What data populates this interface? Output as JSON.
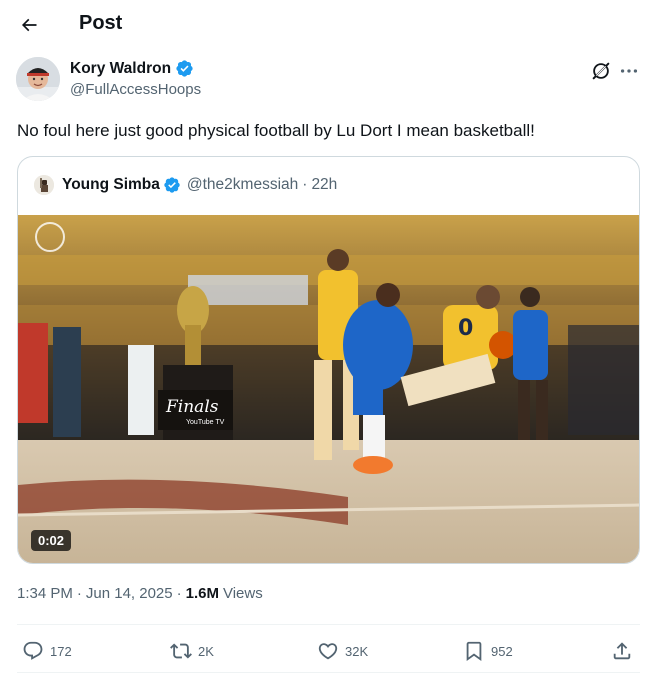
{
  "header": {
    "title": "Post",
    "back_icon": "arrow-left-icon"
  },
  "author": {
    "name": "Kory Waldron",
    "handle": "@FullAccessHoops",
    "verified": true,
    "verified_color": "#1d9bf0"
  },
  "tweet": {
    "text": "No foul here just good physical football by Lu Dort I mean basketball!"
  },
  "quote": {
    "name": "Young Simba",
    "handle": "@the2kmessiah",
    "separator": "·",
    "time": "22h",
    "verified": true,
    "video": {
      "duration": "0:02",
      "overlay_text": [
        "Finals",
        "YouTube TV"
      ]
    }
  },
  "meta": {
    "time": "1:34 PM",
    "sep1": "·",
    "date": "Jun 14, 2025",
    "sep2": "·",
    "views_count": "1.6M",
    "views_label": "Views"
  },
  "actions": {
    "reply": {
      "icon": "reply-icon",
      "count": "172"
    },
    "repost": {
      "icon": "repost-icon",
      "count": "2K"
    },
    "like": {
      "icon": "heart-icon",
      "count": "32K"
    },
    "bookmark": {
      "icon": "bookmark-icon",
      "count": "952"
    },
    "share": {
      "icon": "share-icon"
    }
  },
  "colors": {
    "text": "#0f1419",
    "secondary": "#536471",
    "border": "#cfd9de",
    "accent": "#1d9bf0"
  }
}
